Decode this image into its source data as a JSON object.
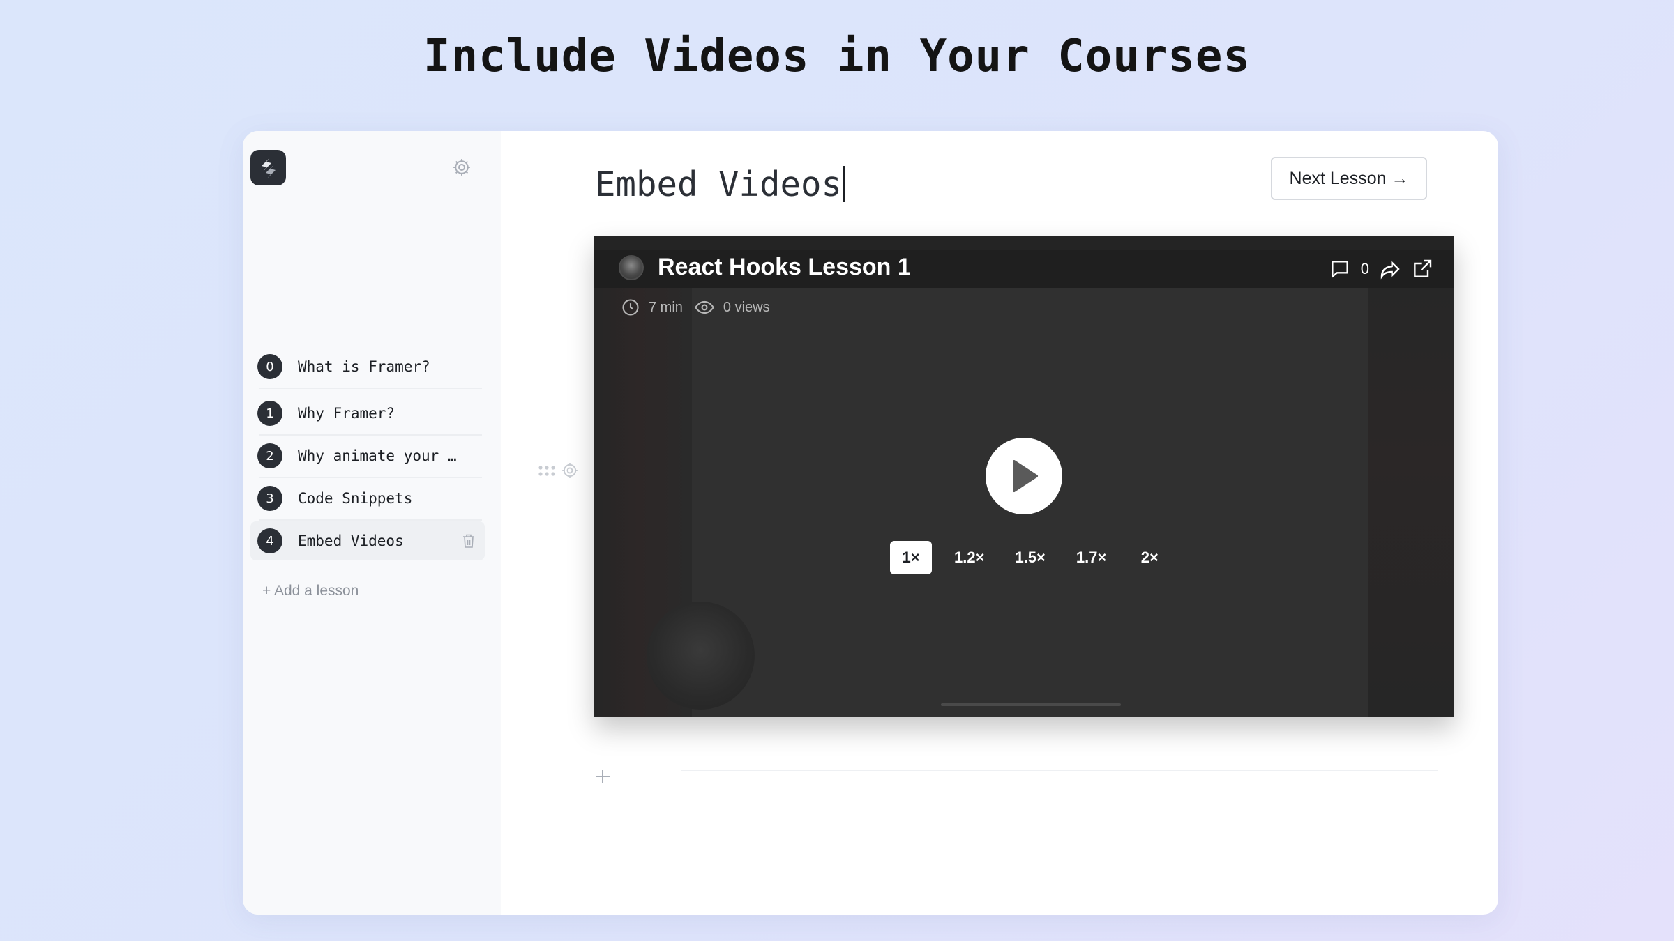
{
  "headline": "Include Videos in Your Courses",
  "sidebar": {
    "lessons": [
      {
        "number": "0",
        "label": "What is Framer?"
      },
      {
        "number": "1",
        "label": "Why Framer?"
      },
      {
        "number": "2",
        "label": "Why animate your …"
      },
      {
        "number": "3",
        "label": "Code Snippets"
      },
      {
        "number": "4",
        "label": "Embed Videos",
        "active": true
      }
    ],
    "add_lesson_label": "+ Add a lesson"
  },
  "main": {
    "title": "Embed Videos",
    "next_lesson_label": "Next Lesson →"
  },
  "video": {
    "title": "React Hooks Lesson 1",
    "duration": "7 min",
    "views": "0 views",
    "comment_count": "0",
    "speeds": [
      "1×",
      "1.2×",
      "1.5×",
      "1.7×",
      "2×"
    ],
    "selected_speed": "1×"
  },
  "colors": {
    "accent_dark": "#2b2f36",
    "video_bg": "#303030",
    "sidebar_bg": "#f8f9fb"
  }
}
